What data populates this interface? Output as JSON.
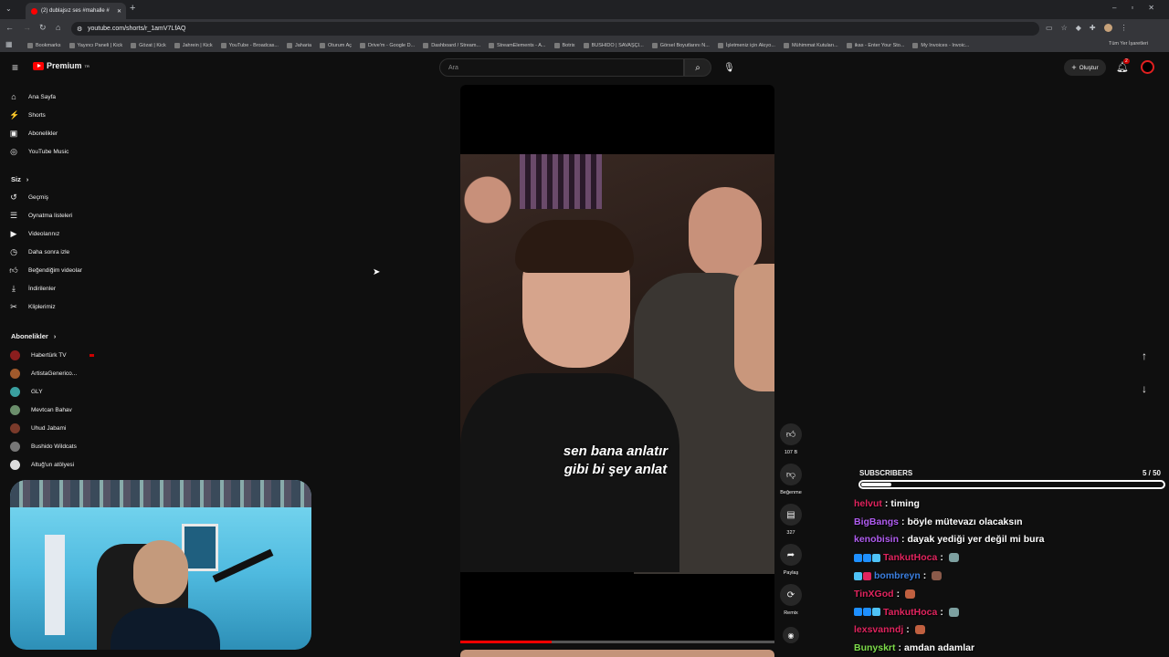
{
  "browser": {
    "tab_title": "(2) dublajsız ses #mahalle #",
    "url": "youtube.com/shorts/r_1amV7LfAQ",
    "bookmarks": [
      "Bookmarks",
      "Yayıncı Paneli | Kick",
      "Gözat | Kick",
      "Jahrein | Kick",
      "YouTube - Broadcas...",
      "Jaharia",
      "Oturum Aç",
      "Drive'm - Google D...",
      "Dashboard / Stream...",
      "StreamElements - A...",
      "Botrix",
      "BUSHIDO | SAVAŞÇI...",
      "Görsel Boyutlarını N...",
      "İşletmeniz için Akıyo...",
      "Mühimmat Kutuları...",
      "ikas - Enter Your Sto...",
      "My Invoices - Invoic..."
    ],
    "all_bookmarks": "Tüm Yer İşaretleri"
  },
  "header": {
    "brand": "Premium",
    "brand_sup": "TR",
    "search_placeholder": "Ara",
    "create_label": "Oluştur",
    "notification_count": "2"
  },
  "sidebar": {
    "main": [
      {
        "label": "Ana Sayfa",
        "icon": "home-icon"
      },
      {
        "label": "Shorts",
        "icon": "shorts-icon"
      },
      {
        "label": "Abonelikler",
        "icon": "subscriptions-icon"
      },
      {
        "label": "YouTube Music",
        "icon": "music-icon"
      }
    ],
    "you_header": "Siz",
    "you": [
      {
        "label": "Geçmiş",
        "icon": "history-icon"
      },
      {
        "label": "Oynatma listeleri",
        "icon": "playlist-icon"
      },
      {
        "label": "Videolarınız",
        "icon": "your-videos-icon"
      },
      {
        "label": "Daha sonra izle",
        "icon": "watch-later-icon"
      },
      {
        "label": "Beğendiğim videolar",
        "icon": "liked-icon"
      },
      {
        "label": "İndirilenler",
        "icon": "download-icon"
      },
      {
        "label": "Kliplerimiz",
        "icon": "clips-icon"
      }
    ],
    "subs_header": "Abonelikler",
    "subscriptions": [
      {
        "label": "Habertürk TV",
        "color": "#8b1e1e"
      },
      {
        "label": "ArtistaGenerico...",
        "color": "#a05a2c"
      },
      {
        "label": "GLY",
        "color": "#3aa0a0"
      },
      {
        "label": "Mevtcan Bahav",
        "color": "#6b8e6b"
      },
      {
        "label": "Uhud Jabami",
        "color": "#7a3a2a"
      },
      {
        "label": "Bushido Wildcats",
        "color": "#777777"
      },
      {
        "label": "Altuğ'un atölyesi",
        "color": "#dddddd"
      }
    ]
  },
  "short": {
    "caption_line1": "sen bana anlatır",
    "caption_line2": "gibi bi şey anlat",
    "progress_fraction": 0.29,
    "actions": [
      {
        "label": "107 B",
        "icon": "like-icon"
      },
      {
        "label": "Beğenme",
        "icon": "dislike-icon"
      },
      {
        "label": "327",
        "icon": "comment-icon"
      },
      {
        "label": "Paylaş",
        "icon": "share-icon"
      },
      {
        "label": "Remix",
        "icon": "remix-icon"
      }
    ]
  },
  "overlay": {
    "subs_label": "SUBSCRIBERS",
    "subs_count": "5",
    "subs_goal": "/ 50",
    "subs_fraction": 0.1,
    "chat": [
      {
        "user": "helvut",
        "color": "#e0245e",
        "text": "timing",
        "badges": [],
        "emote": null
      },
      {
        "user": "BigBangs",
        "color": "#b05cf0",
        "text": "böyle mütevazı olacaksın",
        "badges": [],
        "emote": null
      },
      {
        "user": "kenobisin",
        "color": "#b05cf0",
        "text": "dayak yediği yer değil mi bura",
        "badges": [],
        "emote": null
      },
      {
        "user": "TankutHoca",
        "color": "#e0245e",
        "text": "",
        "badges": [
          "#1e90ff",
          "#1e90ff",
          "#4fc3f7"
        ],
        "emote": "#7da0a0"
      },
      {
        "user": "bombreyn",
        "color": "#3b7fe0",
        "text": "",
        "badges": [
          "#4fc3f7",
          "#e0245e"
        ],
        "emote": "#8a5a4a"
      },
      {
        "user": "TinXGod",
        "color": "#e0245e",
        "text": "",
        "badges": [],
        "emote": "#c06040"
      },
      {
        "user": "TankutHoca",
        "color": "#e0245e",
        "text": "",
        "badges": [
          "#1e90ff",
          "#1e90ff",
          "#4fc3f7"
        ],
        "emote": "#7da0a0"
      },
      {
        "user": "lexsvanndj",
        "color": "#e0245e",
        "text": "",
        "badges": [],
        "emote": "#c06040"
      },
      {
        "user": "Bunyskrt",
        "color": "#7ddc4a",
        "text": "amdan adamlar",
        "badges": [],
        "emote": null
      }
    ]
  }
}
